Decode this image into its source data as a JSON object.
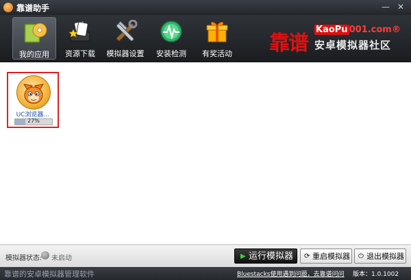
{
  "window": {
    "title": "靠谱助手",
    "controls": {
      "minimize": "—",
      "close": "✕"
    }
  },
  "toolbar": {
    "items": [
      {
        "label": "我的应用",
        "icon": "book-disc-icon",
        "active": true
      },
      {
        "label": "资源下载",
        "icon": "game-cards-icon",
        "active": false
      },
      {
        "label": "模拟器设置",
        "icon": "tools-icon",
        "active": false
      },
      {
        "label": "安装检测",
        "icon": "health-check-icon",
        "active": false
      },
      {
        "label": "有奖活动",
        "icon": "gift-box-icon",
        "active": false
      }
    ]
  },
  "brand": {
    "big": "靠谱",
    "url_highlight": "KaoPu",
    "url_rest": "001.com",
    "url_suffix": "®",
    "subtitle": "安卓模拟器社区"
  },
  "apps": [
    {
      "name": "UC浏览器…",
      "progress_label": "27%",
      "progress": 0.27,
      "icon": "uc-browser-squirrel-icon"
    }
  ],
  "status": {
    "label": "模拟器状态:",
    "value": "未启动"
  },
  "actions": {
    "run": "运行模拟器",
    "restart": "重启模拟器",
    "exit": "退出模拟器"
  },
  "footer": {
    "left": "靠谱的安卓模拟器管理软件",
    "link": "Bluestacks使用遇到问题，去靠谱问问",
    "version": "版本：1.0.1002"
  },
  "colors": {
    "brand_red": "#e01010",
    "selection_border": "#e02020",
    "run_icon_green": "#3ad23a"
  }
}
